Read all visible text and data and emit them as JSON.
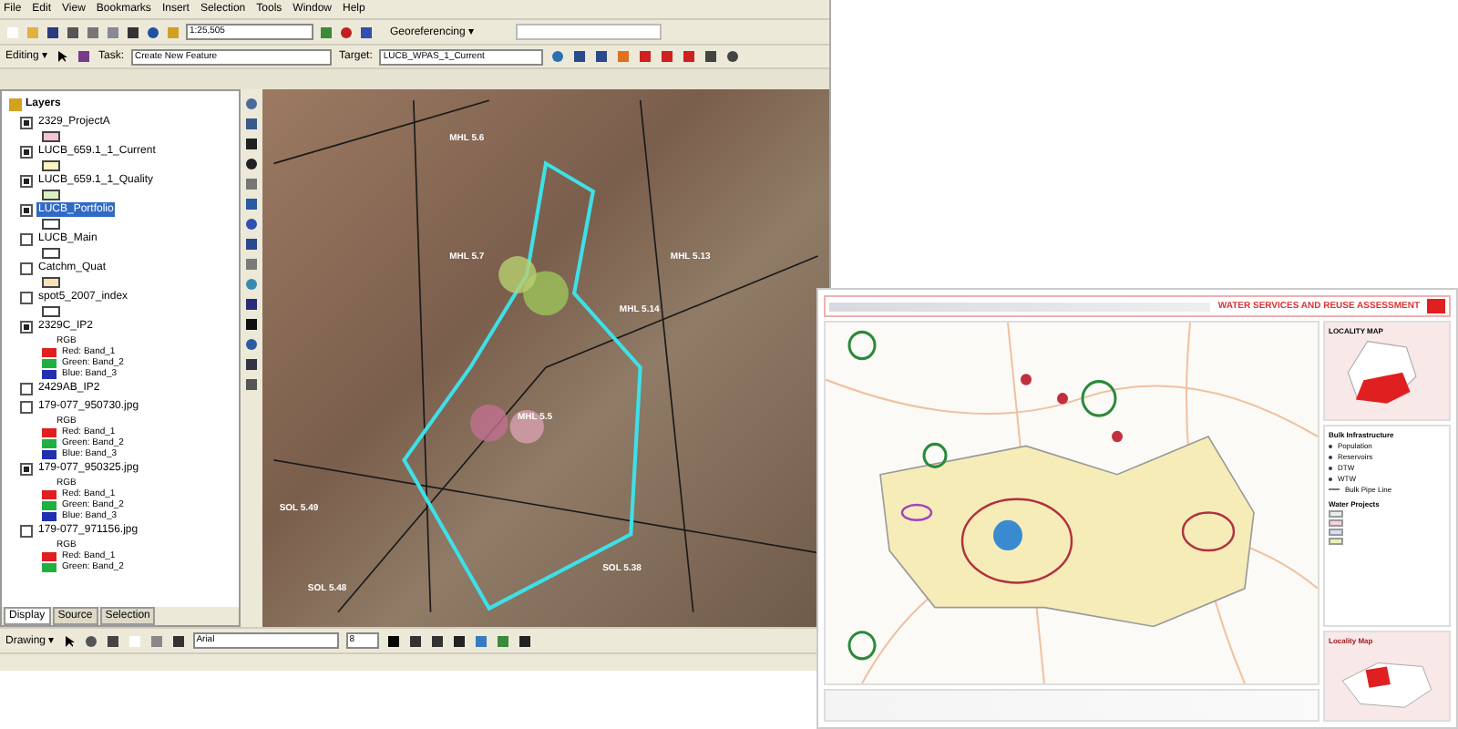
{
  "arcmap": {
    "menu": [
      "File",
      "Edit",
      "View",
      "Bookmarks",
      "Insert",
      "Selection",
      "Tools",
      "Window",
      "Help"
    ],
    "scale": "1:25,505",
    "georeferencing": "Georeferencing ▾",
    "editor": "Editing ▾",
    "task_label": "Task:",
    "task": "Create New Feature",
    "target_label": "Target:",
    "target": "LUCB_WPAS_1_Current",
    "toc": {
      "title": "Layers",
      "layers": [
        {
          "name": "2329_ProjectA",
          "checked": true,
          "selected": false,
          "color": "#f3c4d0"
        },
        {
          "name": "LUCB_659.1_1_Current",
          "checked": true,
          "selected": false,
          "color": "#fdf2c0"
        },
        {
          "name": "LUCB_659.1_1_Quality",
          "checked": true,
          "selected": false,
          "color": "#dcefc4"
        },
        {
          "name": "LUCB_Portfolio",
          "checked": true,
          "selected": true,
          "color": "#ffffff"
        },
        {
          "name": "LUCB_Main",
          "checked": false,
          "selected": false,
          "color": "#ffffff"
        },
        {
          "name": "Catchm_Quat",
          "checked": false,
          "selected": false,
          "color": "#fbe2b8"
        },
        {
          "name": "spot5_2007_index",
          "checked": false,
          "selected": false,
          "color": "#ffffff"
        },
        {
          "name": "2329C_IP2",
          "checked": true,
          "selected": false,
          "render": "RGB",
          "bands": [
            {
              "label": "Red: Band_1",
              "color": "#e02020"
            },
            {
              "label": "Green: Band_2",
              "color": "#20b040"
            },
            {
              "label": "Blue: Band_3",
              "color": "#2030b0"
            }
          ]
        },
        {
          "name": "2429AB_IP2",
          "checked": false,
          "selected": false
        },
        {
          "name": "179-077_950730.jpg",
          "checked": false,
          "selected": false,
          "render": "RGB",
          "bands": [
            {
              "label": "Red: Band_1",
              "color": "#e02020"
            },
            {
              "label": "Green: Band_2",
              "color": "#20b040"
            },
            {
              "label": "Blue: Band_3",
              "color": "#2030b0"
            }
          ]
        },
        {
          "name": "179-077_950325.jpg",
          "checked": true,
          "selected": false,
          "render": "RGB",
          "bands": [
            {
              "label": "Red: Band_1",
              "color": "#e02020"
            },
            {
              "label": "Green: Band_2",
              "color": "#20b040"
            },
            {
              "label": "Blue: Band_3",
              "color": "#2030b0"
            }
          ]
        },
        {
          "name": "179-077_971156.jpg",
          "checked": false,
          "selected": false,
          "render": "RGB",
          "bands": [
            {
              "label": "Red: Band_1",
              "color": "#e02020"
            },
            {
              "label": "Green: Band_2",
              "color": "#20b040"
            }
          ]
        }
      ]
    },
    "toc_tabs": [
      {
        "label": "Display",
        "selected": true
      },
      {
        "label": "Source",
        "selected": false
      },
      {
        "label": "Selection",
        "selected": false
      }
    ],
    "map_labels": [
      "MHL 5.6",
      "MHL 5.7",
      "MHL 5.13",
      "MHL 5.14",
      "MHL 5.5",
      "SOL 5.49",
      "SOL 5.48",
      "SOL 5.38"
    ],
    "drawing": "Drawing ▾",
    "font": "Arial",
    "font_size": "8"
  },
  "report_map": {
    "heading": "WATER SERVICES AND REUSE ASSESSMENT",
    "locality_title": "LOCALITY MAP",
    "legend": {
      "title": "Bulk Infrastructure",
      "items": [
        {
          "label": "Population",
          "kind": "dot"
        },
        {
          "label": "Reservoirs",
          "kind": "dot"
        },
        {
          "label": "DTW",
          "kind": "dot"
        },
        {
          "label": "WTW",
          "kind": "dot"
        },
        {
          "label": "Bulk Pipe Line",
          "kind": "line"
        }
      ]
    },
    "projects_title": "Water Projects",
    "inset_title": "Locality Map"
  }
}
